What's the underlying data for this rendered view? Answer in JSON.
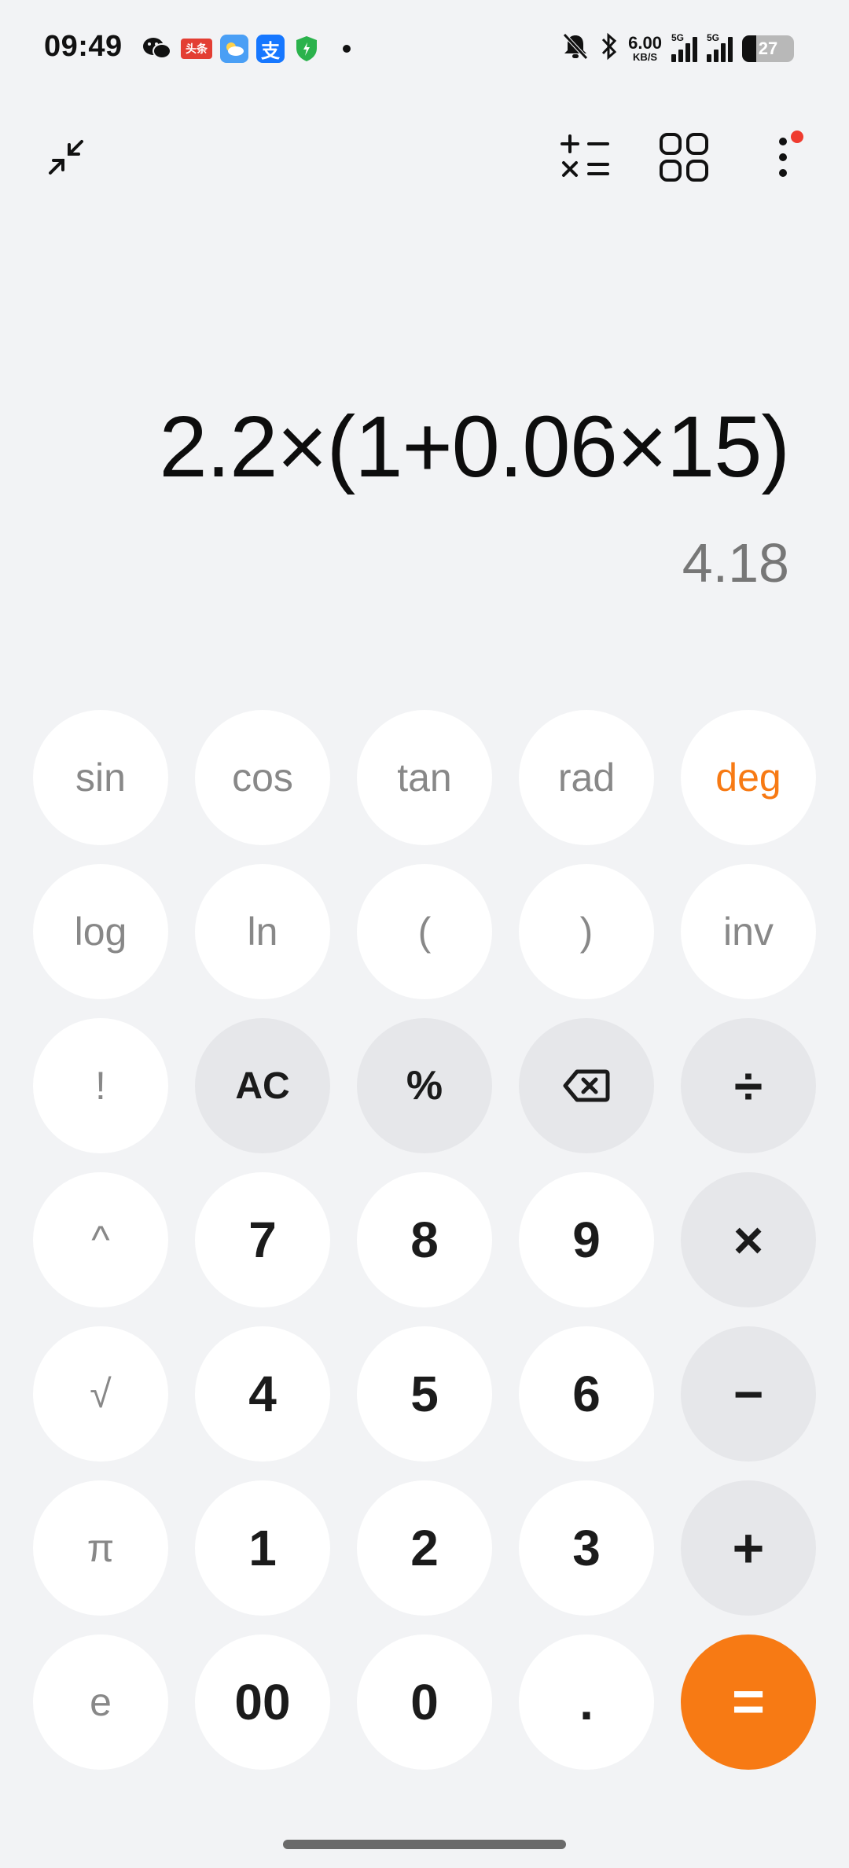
{
  "status_bar": {
    "time": "09:49",
    "net_speed_value": "6.00",
    "net_speed_unit": "KB/S",
    "signal1_tag": "5G",
    "signal2_tag": "5G",
    "battery_level": "27",
    "battery_fraction": 0.27,
    "app_icons": [
      "wechat-icon",
      "toutiao-icon",
      "weather-icon",
      "alipay-icon",
      "security-shield-icon"
    ],
    "toutiao_label": "头条",
    "alipay_label": "支"
  },
  "toolbar": {
    "collapse_icon": "collapse-arrows-icon",
    "convert_icon": "unit-converter-icon",
    "apps_icon": "grid-apps-icon",
    "more_icon": "more-vertical-icon",
    "has_notification": true
  },
  "display": {
    "expression": "2.2×(1+0.06×15)",
    "result": "4.18"
  },
  "keys": {
    "r1": [
      "sin",
      "cos",
      "tan",
      "rad",
      "deg"
    ],
    "r2": [
      "log",
      "ln",
      "(",
      ")",
      "inv"
    ],
    "r3": [
      "!",
      "AC",
      "%",
      "⌫",
      "÷"
    ],
    "r4": [
      "^",
      "7",
      "8",
      "9",
      "×"
    ],
    "r5": [
      "√",
      "4",
      "5",
      "6",
      "−"
    ],
    "r6": [
      "π",
      "1",
      "2",
      "3",
      "+"
    ],
    "r7": [
      "e",
      "00",
      "0",
      ".",
      "="
    ]
  },
  "colors": {
    "accent": "#f77a14",
    "background": "#f2f3f5",
    "key": "#ffffff",
    "op_key": "#e6e7ea",
    "notification": "#ef3b2f"
  }
}
